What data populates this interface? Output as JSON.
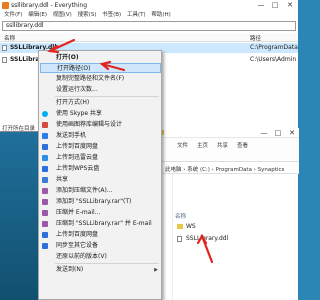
{
  "everything": {
    "title": "ssllibrary.ddl - Everything",
    "menu": [
      "文件(F)",
      "编辑(E)",
      "视图(V)",
      "搜索(S)",
      "书签(B)",
      "工具(T)",
      "帮助(H)"
    ],
    "search_value": "ssllibrary.ddl",
    "columns": {
      "name": "名称",
      "path": "路径"
    },
    "rows": [
      {
        "name": "SSLLibrary.dll",
        "path": "C:\\ProgramData"
      },
      {
        "name": "SSLLibrary.dll",
        "path": "C:\\Users\\Admin"
      }
    ],
    "status": "打开所在目录"
  },
  "window_buttons": {
    "minimize": "—",
    "maximize": "□",
    "close": "✕"
  },
  "context_menu": {
    "items": [
      {
        "label": "打开(O)",
        "icon_color": "",
        "bold": true
      },
      {
        "label": "打开路径(O)",
        "icon_color": "",
        "highlight": true
      },
      {
        "label": "复制完整路径和文件名(F)",
        "icon_color": ""
      },
      {
        "label": "设置运行次数...",
        "icon_color": ""
      },
      {
        "label": "打开方式(H)",
        "icon_color": ""
      },
      {
        "label": "使用 Skype 共享",
        "icon_color": "#00aff0"
      },
      {
        "label": "使用画图荐库编辑与设计",
        "icon_color": "#d64b3c"
      },
      {
        "label": "发送到手机",
        "icon_color": "#2b7de9"
      },
      {
        "label": "上传到百度网盘",
        "icon_color": "#2f6fdc"
      },
      {
        "label": "上传到迅雷云盘",
        "icon_color": "#2f8fe6"
      },
      {
        "label": "上传到WPS云盘",
        "icon_color": "#2b6fe0"
      },
      {
        "label": "共享",
        "icon_color": "#3b7bd6"
      },
      {
        "label": "添加到压缩文件(A)...",
        "icon_color": "#9a5aa8"
      },
      {
        "label": "添加到 \"SSLLibrary.rar\"(T)",
        "icon_color": "#9a5aa8"
      },
      {
        "label": "压缩并 E-mail...",
        "icon_color": "#9a5aa8"
      },
      {
        "label": "压缩到 \"SSLLibrary.rar\" 并 E-mail",
        "icon_color": "#9a5aa8"
      },
      {
        "label": "上传到百度网盘",
        "icon_color": "#2f6fdc"
      },
      {
        "label": "同步至其它设备",
        "icon_color": "#2f6fdc"
      },
      {
        "label": "还原以前的版本(V)",
        "icon_color": ""
      },
      {
        "label": "发送到(N)",
        "icon_color": "",
        "submenu": true
      }
    ],
    "submenu_arrow": "▶"
  },
  "explorer": {
    "ribbon_tabs": [
      "文件",
      "主页",
      "共享",
      "查看"
    ],
    "breadcrumbs": "此电脑 › 系统 (C:) › ProgramData › Synaptics",
    "column_name": "名称",
    "items": [
      {
        "name": "WS",
        "type": "folder"
      },
      {
        "name": "SSLLibrary.ddl",
        "type": "file"
      }
    ]
  },
  "annotation_color": "#e0261f"
}
